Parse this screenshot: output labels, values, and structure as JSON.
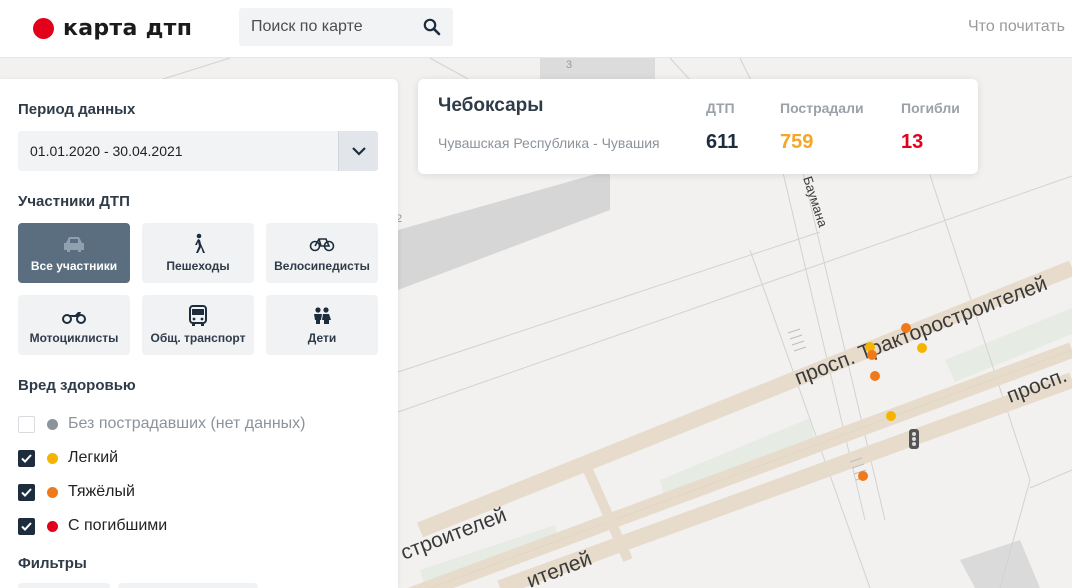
{
  "header": {
    "logo_text": "карта дтп",
    "search_placeholder": "Поиск по карте",
    "read_link": "Что почитать",
    "icons": {
      "logo": "logo-dot",
      "search": "search-icon"
    }
  },
  "panel": {
    "period_title": "Период данных",
    "period_value": "01.01.2020 - 30.04.2021",
    "participants_title": "Участники ДТП",
    "participants": [
      {
        "label": "Все участники",
        "icon": "car-icon",
        "active": true
      },
      {
        "label": "Пешеходы",
        "icon": "pedestrian-icon",
        "active": false
      },
      {
        "label": "Велосипедисты",
        "icon": "bicycle-icon",
        "active": false
      },
      {
        "label": "Мотоциклисты",
        "icon": "motorcycle-icon",
        "active": false
      },
      {
        "label": "Общ. транспорт",
        "icon": "bus-icon",
        "active": false
      },
      {
        "label": "Дети",
        "icon": "children-icon",
        "active": false
      }
    ],
    "harm_title": "Вред здоровью",
    "harm": [
      {
        "label": "Без пострадавших (нет данных)",
        "checked": false,
        "color": "#8b939b"
      },
      {
        "label": "Легкий",
        "checked": true,
        "color": "#f5b400"
      },
      {
        "label": "Тяжёлый",
        "checked": true,
        "color": "#f07a1a"
      },
      {
        "label": "С погибшими",
        "checked": true,
        "color": "#e2001a"
      }
    ],
    "filters_title": "Фильтры"
  },
  "card": {
    "city": "Чебоксары",
    "region": "Чувашская Республика - Чувашия",
    "stats": [
      {
        "label": "ДТП",
        "value": "611",
        "color": "#1d2d3d"
      },
      {
        "label": "Пострадали",
        "value": "759",
        "color": "#f5a623"
      },
      {
        "label": "Погибли",
        "value": "13",
        "color": "#e2001a"
      }
    ]
  },
  "map": {
    "street_labels": [
      "просп. Тракторостроителей",
      "просп.",
      "Баумана",
      "строителей",
      "ителей",
      "3",
      "2"
    ],
    "incident_colors": {
      "light": "#f5b400",
      "severe": "#f07a1a"
    }
  }
}
